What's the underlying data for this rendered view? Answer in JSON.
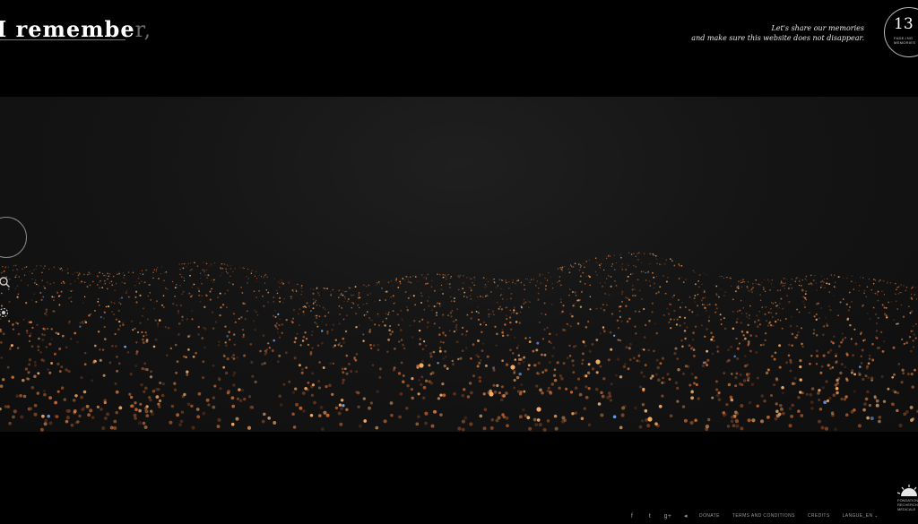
{
  "header": {
    "logo_main": "I rememb",
    "logo_e": "e",
    "logo_faded": "r,",
    "tagline_line1": "Let's share our memories",
    "tagline_line2": "and make sure this website does not disappear.",
    "counter_number": "13",
    "counter_label": "FADE-ING MEMORIES"
  },
  "side_controls": {
    "items": [
      {
        "icon": "orb-navigator-icon"
      },
      {
        "icon": "search-icon"
      },
      {
        "icon": "settings-icon"
      }
    ]
  },
  "footer": {
    "logo_text": "FONDATION RECHERCHE MEDICALE",
    "social": [
      {
        "icon": "facebook-icon",
        "glyph": "f"
      },
      {
        "icon": "twitter-icon",
        "glyph": "t"
      },
      {
        "icon": "googleplus-icon",
        "glyph": "g+"
      },
      {
        "icon": "sound-icon",
        "glyph": "◂"
      }
    ],
    "links": [
      {
        "label": "DONATE"
      },
      {
        "label": "TERMS AND CONDITIONS"
      },
      {
        "label": "CREDITS"
      },
      {
        "label": "LANGUE_EN ⌄"
      }
    ]
  },
  "colors": {
    "particle_bright": "#ffb36b",
    "particle_mid": "#c96a32",
    "particle_dim": "#6e3a1f",
    "particle_blue": "#7fb0ff"
  }
}
